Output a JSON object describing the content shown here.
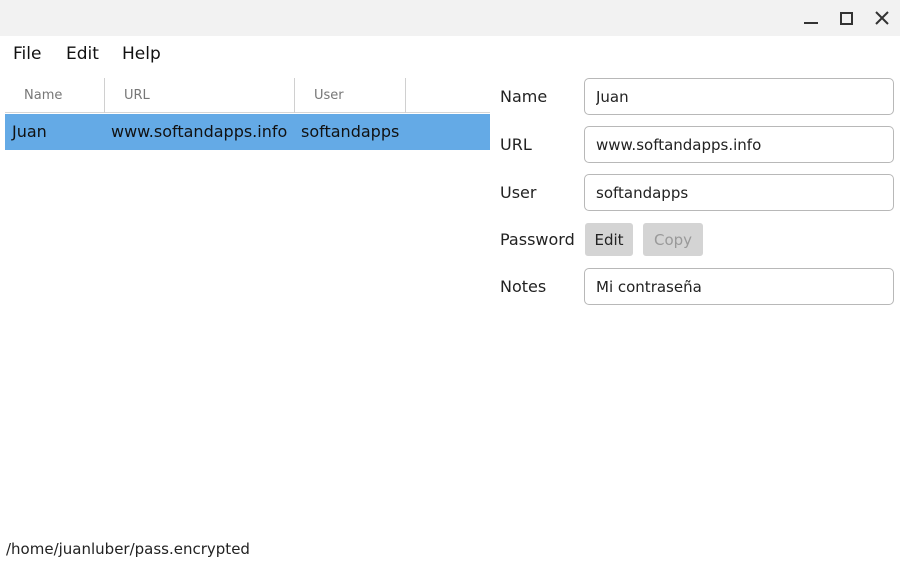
{
  "window": {
    "controls": [
      "minimize-icon",
      "maximize-icon",
      "close-icon"
    ]
  },
  "menu": {
    "file": "File",
    "edit": "Edit",
    "help": "Help"
  },
  "table": {
    "columns": [
      "Name",
      "URL",
      "User"
    ],
    "rows": [
      {
        "name": "Juan",
        "url": "www.softandapps.info",
        "user": "softandapps",
        "selected": true
      }
    ],
    "selected_color": "#64aae6"
  },
  "form": {
    "name_label": "Name",
    "name_value": "Juan",
    "url_label": "URL",
    "url_value": "www.softandapps.info",
    "user_label": "User",
    "user_value": "softandapps",
    "password_label": "Password",
    "edit_button": "Edit",
    "copy_button": "Copy",
    "notes_label": "Notes",
    "notes_value": "Mi contraseña"
  },
  "status": {
    "file_path": "/home/juanluber/pass.encrypted"
  }
}
